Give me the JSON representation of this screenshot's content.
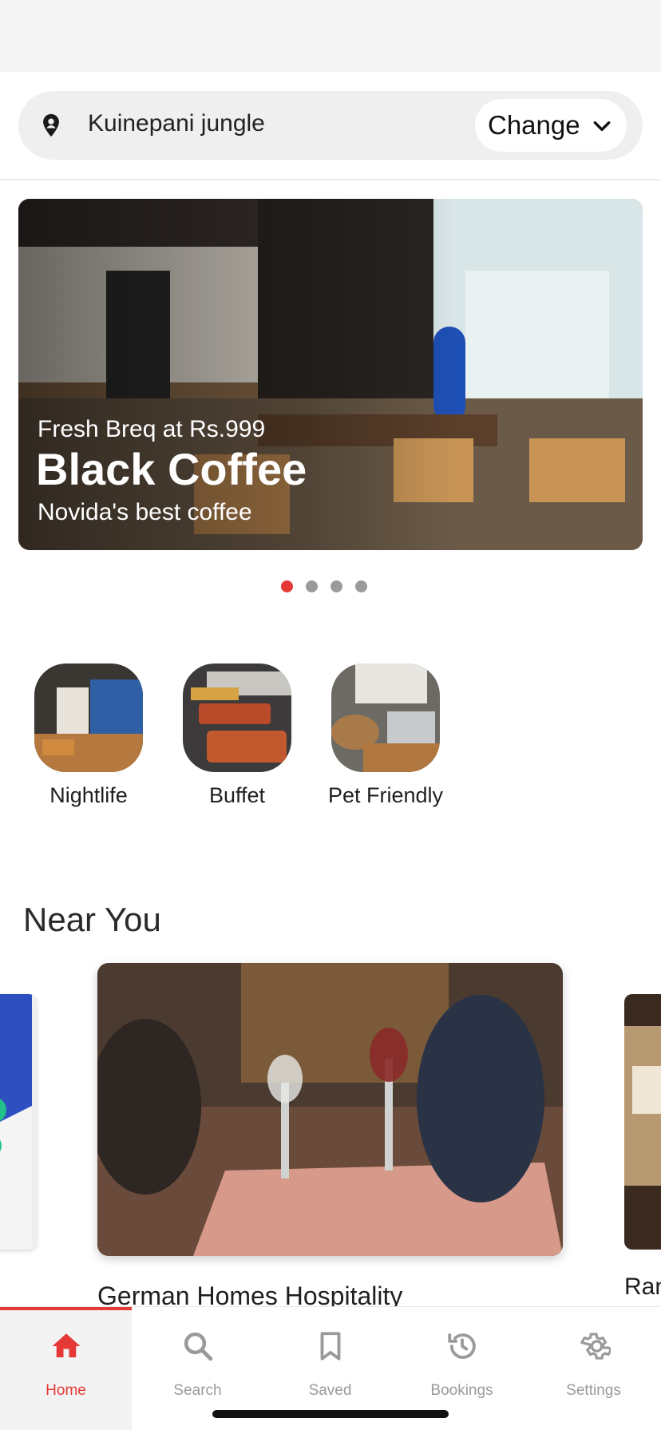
{
  "location": {
    "name": "Kuinepani jungle",
    "change_label": "Change",
    "pin_icon": "location-pin-icon",
    "chevron_icon": "chevron-down-icon"
  },
  "banner": {
    "kicker": "Fresh Breq at Rs.999",
    "title": "Black Coffee",
    "subtitle": "Novida's best coffee",
    "active_slide": 1,
    "total_slides": 4
  },
  "categories": [
    {
      "label": "Nightlife"
    },
    {
      "label": "Buffet"
    },
    {
      "label": "Pet Friendly"
    }
  ],
  "near_you": {
    "title": "Near You",
    "cards": [
      {
        "name": "German Homes Hospitality"
      },
      {
        "name": "Ran"
      }
    ]
  },
  "tabs": [
    {
      "label": "Home",
      "icon": "home-icon",
      "active": true
    },
    {
      "label": "Search",
      "icon": "search-icon",
      "active": false
    },
    {
      "label": "Saved",
      "icon": "bookmark-icon",
      "active": false
    },
    {
      "label": "Bookings",
      "icon": "history-icon",
      "active": false
    },
    {
      "label": "Settings",
      "icon": "gear-icon",
      "active": false
    }
  ],
  "colors": {
    "accent": "#e53935",
    "inactive": "#9a9a9a"
  }
}
